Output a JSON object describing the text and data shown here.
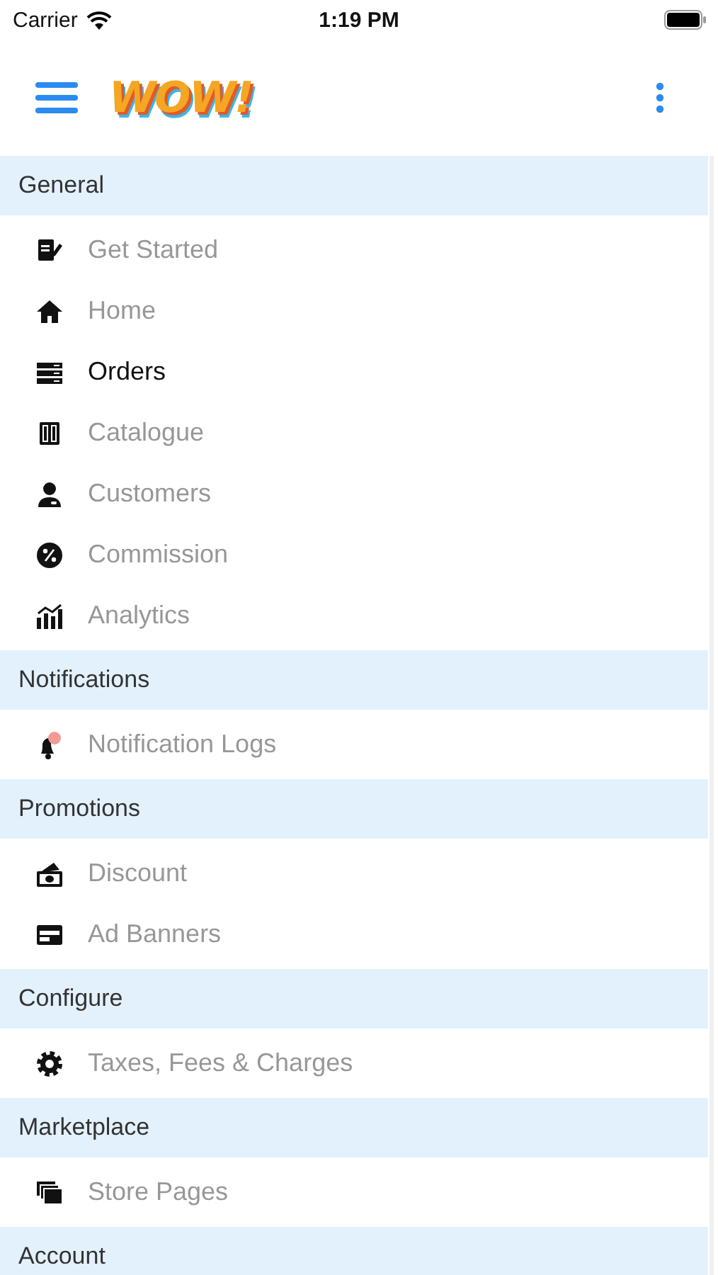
{
  "status_bar": {
    "carrier": "Carrier",
    "time": "1:19 PM"
  },
  "header": {
    "logo_text": "WOW!"
  },
  "sections": [
    {
      "title": "General",
      "items": [
        {
          "label": "Get Started",
          "selected": false
        },
        {
          "label": "Home",
          "selected": false
        },
        {
          "label": "Orders",
          "selected": true
        },
        {
          "label": "Catalogue",
          "selected": false
        },
        {
          "label": "Customers",
          "selected": false
        },
        {
          "label": "Commission",
          "selected": false
        },
        {
          "label": "Analytics",
          "selected": false
        }
      ]
    },
    {
      "title": "Notifications",
      "items": [
        {
          "label": "Notification Logs",
          "selected": false
        }
      ]
    },
    {
      "title": "Promotions",
      "items": [
        {
          "label": "Discount",
          "selected": false
        },
        {
          "label": "Ad Banners",
          "selected": false
        }
      ]
    },
    {
      "title": "Configure",
      "items": [
        {
          "label": "Taxes, Fees & Charges",
          "selected": false
        }
      ]
    },
    {
      "title": "Marketplace",
      "items": [
        {
          "label": "Store Pages",
          "selected": false
        }
      ]
    },
    {
      "title": "Account"
    }
  ]
}
